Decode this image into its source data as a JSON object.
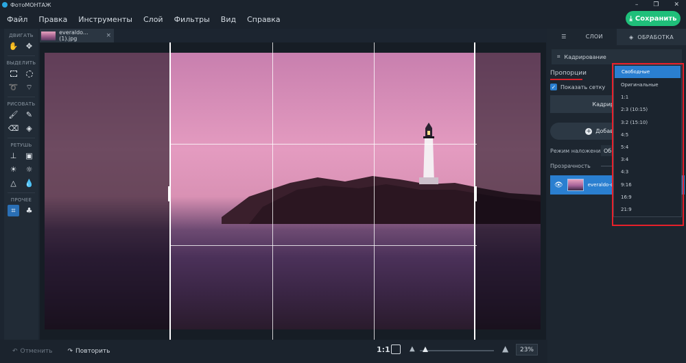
{
  "app": {
    "title": "ФотоМОНТАЖ",
    "window_controls": [
      "–",
      "❐",
      "✕"
    ]
  },
  "menu": [
    "Файл",
    "Правка",
    "Инструменты",
    "Слой",
    "Фильтры",
    "Вид",
    "Справка"
  ],
  "save_button": {
    "label": "Сохранить",
    "icon": "download-icon"
  },
  "toolbar": {
    "groups": [
      {
        "label": "ДВИГАТЬ",
        "tools": [
          "hand-icon",
          "move-icon"
        ]
      },
      {
        "label": "ВЫДЕЛИТЬ",
        "tools": [
          "rect-select-icon",
          "ellipse-select-icon",
          "lasso-icon",
          "poly-lasso-icon"
        ]
      },
      {
        "label": "РИСОВАТЬ",
        "tools": [
          "brush-icon",
          "pencil-icon",
          "eraser-icon",
          "fill-icon"
        ]
      },
      {
        "label": "РЕТУШЬ",
        "tools": [
          "stamp-icon",
          "patch-icon",
          "dodge-icon",
          "burn-icon",
          "sharpen-icon",
          "blur-icon"
        ]
      },
      {
        "label": "ПРОЧЕЕ",
        "tools": [
          "crop-icon",
          "shapes-icon"
        ]
      }
    ]
  },
  "document_tab": {
    "name": "everaldo... (1).jpg",
    "close": "×"
  },
  "bottom": {
    "undo": "Отменить",
    "redo": "Повторить",
    "one_to_one": "1:1",
    "zoom": "23%"
  },
  "panel": {
    "tabs": [
      "СЛОИ",
      "ОБРАБОТКА"
    ],
    "crop_tool_label": "Кадрирование",
    "proportions_label": "Пропорции",
    "show_grid_label": "Показать сетку",
    "crop_apply_label": "Кадрир",
    "add_layer_label": "Добавить слой",
    "blend_label": "Режим наложения:",
    "blend_value": "Обы",
    "opacity_label": "Прозрачность",
    "layer_name": "everaldo-c"
  },
  "proportions_dropdown": {
    "selected": "Свободные",
    "options": [
      "Свободные",
      "Оригинальные",
      "1:1",
      "2:3 (10:15)",
      "3:2 (15:10)",
      "4:5",
      "5:4",
      "3:4",
      "4:3",
      "9:16",
      "16:9",
      "21:9"
    ]
  },
  "colors": {
    "accent": "#2a7fd0",
    "save": "#1fbf7a",
    "highlight": "#e8202a"
  }
}
